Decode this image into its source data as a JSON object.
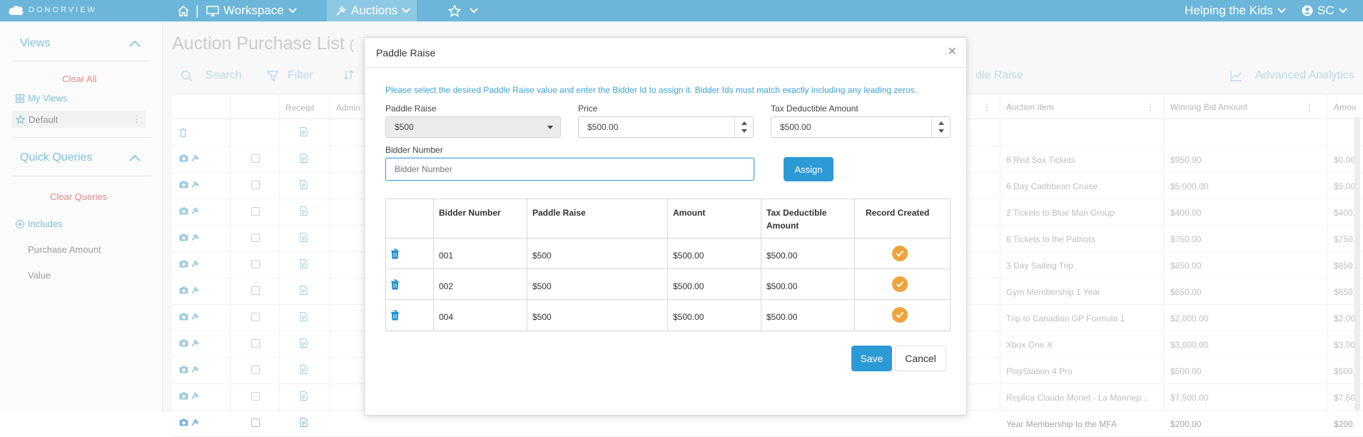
{
  "topbar": {
    "logo_text": "DONORVIEW",
    "workspace_label": "Workspace",
    "auctions_label": "Auctions",
    "org_label": "Helping the Kids",
    "user_initials": "SC"
  },
  "sidebar": {
    "views_title": "Views",
    "clear_all": "Clear All",
    "my_views": "My Views",
    "default_view": "Default",
    "quick_queries_title": "Quick Queries",
    "clear_queries": "Clear Queries",
    "includes": "Includes",
    "items": [
      "Purchase Amount",
      "Value"
    ]
  },
  "page": {
    "title": "Auction Purchase List",
    "title_suffix": "(",
    "toolbar": {
      "search": "Search",
      "filter": "Filter",
      "paddle_raise_link": "dle Raise",
      "advanced_analytics": "Advanced Analytics"
    },
    "grid": {
      "headers": {
        "receipt": "Receipt",
        "admin": "Admin",
        "auction_item": "Auction Item",
        "winning_bid": "Winning Bid Amount",
        "amount": "Amou"
      },
      "rows": [
        {
          "item": "8 Red Sox Tickets",
          "bid": "$950.00",
          "amount": "$0.00"
        },
        {
          "item": "6 Day Caribbean Cruise",
          "bid": "$5,000.00",
          "amount": "$5,00"
        },
        {
          "item": "2 Tickets to Blue Man Group",
          "bid": "$400.00",
          "amount": "$400."
        },
        {
          "item": "6 Tickets to the Patriots",
          "bid": "$750.00",
          "amount": "$750."
        },
        {
          "item": "3 Day Sailing Trip",
          "bid": "$850.00",
          "amount": "$850."
        },
        {
          "item": "Gym Membership 1 Year",
          "bid": "$650.00",
          "amount": "$650."
        },
        {
          "item": "Trip to Canadian GP Formula 1",
          "bid": "$2,000.00",
          "amount": "$2,00"
        },
        {
          "item": "Xbox One X",
          "bid": "$3,000.00",
          "amount": "$3,00"
        },
        {
          "item": "PlayStation 4 Pro",
          "bid": "$500.00",
          "amount": "$500."
        },
        {
          "item": "Replica Claude Monet - La Mannep...",
          "bid": "$7,500.00",
          "amount": "$7,50"
        },
        {
          "item": "Year Membership to the MFA",
          "bid": "$200.00",
          "amount": "$200."
        }
      ]
    }
  },
  "modal": {
    "title": "Paddle Raise",
    "close": "×",
    "instructions": "Please select the desired Paddle Raise value and enter the Bidder Id to assign it. Bidder Ids must match exactly including any leading zeros.",
    "paddle_raise_label": "Paddle Raise",
    "paddle_raise_value": "$500",
    "price_label": "Price",
    "price_value": "$500.00",
    "tax_label": "Tax Deductible Amount",
    "tax_value": "$500.00",
    "bidder_label": "Bidder Number",
    "bidder_placeholder": "Bidder Number",
    "assign_button": "Assign",
    "table": {
      "headers": [
        "Bidder Number",
        "Paddle Raise",
        "Amount",
        "Tax Deductible",
        "Amount",
        "Record Created"
      ],
      "rows": [
        {
          "bidder": "001",
          "paddle": "$500",
          "amount": "$500.00",
          "tax": "$500.00"
        },
        {
          "bidder": "002",
          "paddle": "$500",
          "amount": "$500.00",
          "tax": "$500.00"
        },
        {
          "bidder": "004",
          "paddle": "$500",
          "amount": "$500.00",
          "tax": "$500.00"
        }
      ]
    },
    "save_button": "Save",
    "cancel_button": "Cancel"
  },
  "colors": {
    "topbar": "#6cb6d9",
    "accent": "#2c9ad5",
    "check": "#f0a23b",
    "link_red": "#e25b5b"
  }
}
